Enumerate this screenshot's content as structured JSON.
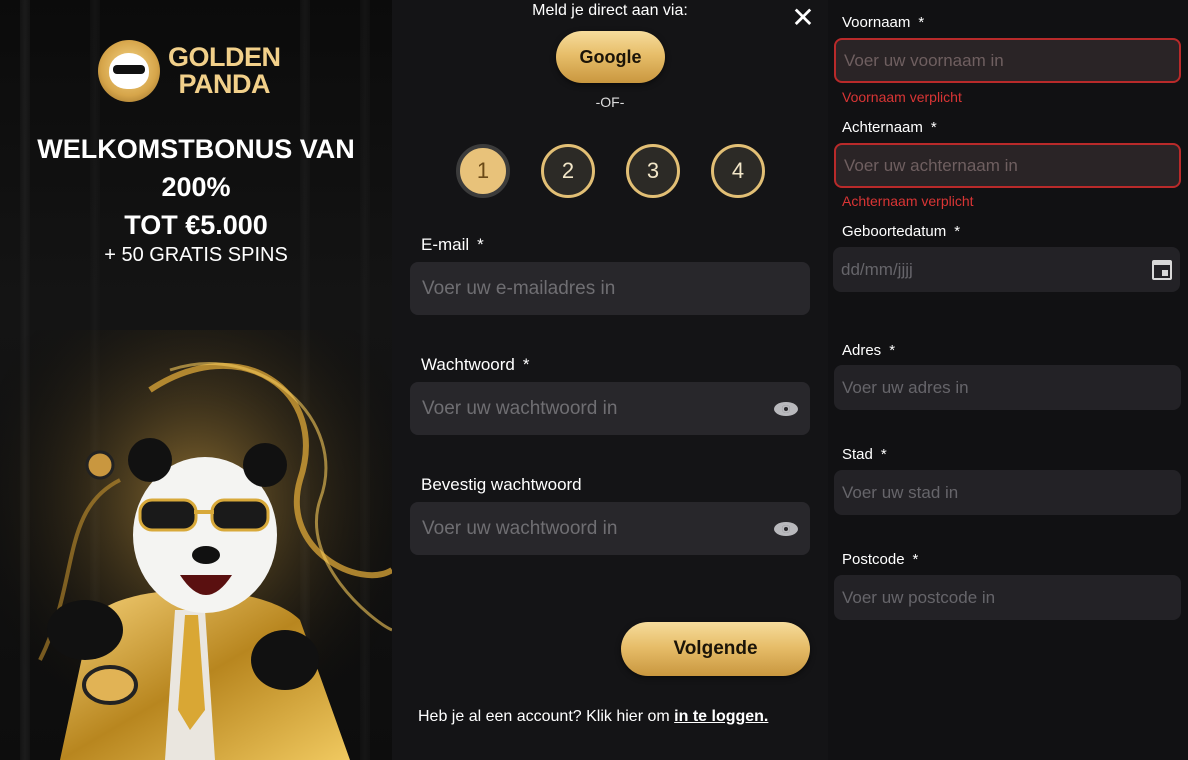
{
  "promo": {
    "logo_line1": "GOLDEN",
    "logo_line2": "PANDA",
    "headline_1": "WELKOMSTBONUS VAN",
    "headline_2": "200%",
    "headline_3": "TOT €5.000",
    "subline": "+ 50 GRATIS SPINS"
  },
  "signup": {
    "meld_label": "Meld je direct aan via:",
    "google_label": "Google",
    "or_label": "-OF-",
    "steps": [
      "1",
      "2",
      "3",
      "4"
    ],
    "active_step": 1,
    "email_label": "E-mail",
    "email_placeholder": "Voer uw e-mailadres in",
    "password_label": "Wachtwoord",
    "password_placeholder": "Voer uw wachtwoord in",
    "confirm_label": "Bevestig wachtwoord",
    "confirm_placeholder": "Voer uw wachtwoord in",
    "required_mark": "*",
    "next_label": "Volgende",
    "login_text": "Heb je al een account? Klik hier om",
    "login_link": "in te loggen."
  },
  "details": {
    "firstname_label": "Voornaam",
    "firstname_placeholder": "Voer uw voornaam in",
    "firstname_error": "Voornaam verplicht",
    "lastname_label": "Achternaam",
    "lastname_placeholder": "Voer uw achternaam in",
    "lastname_error": "Achternaam verplicht",
    "birthdate_label": "Geboortedatum",
    "birthdate_placeholder": "dd/mm/jjjj",
    "address_label": "Adres",
    "address_placeholder": "Voer uw adres in",
    "city_label": "Stad",
    "city_placeholder": "Voer uw stad in",
    "postcode_label": "Postcode",
    "postcode_placeholder": "Voer uw postcode in"
  },
  "colors": {
    "gold": "#e7be6a",
    "error": "#d93535",
    "field_bg": "#28272b"
  }
}
